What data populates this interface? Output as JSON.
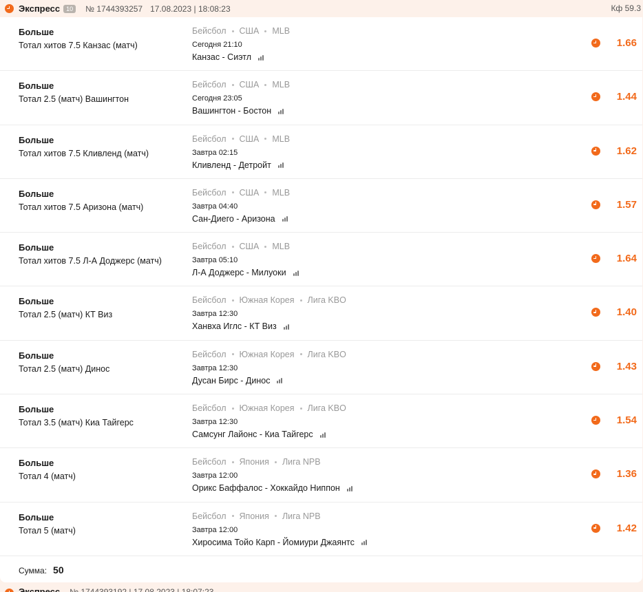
{
  "header": {
    "title": "Экспресс",
    "badge": "10",
    "number": "№ 1744393257",
    "date": "17.08.2023 | 18:08:23",
    "coef": "Кф 59.3"
  },
  "bets": [
    {
      "market": "Больше",
      "outcome": "Тотал хитов 7.5 Канзас (матч)",
      "sport": "Бейсбол",
      "country": "США",
      "league": "MLB",
      "time": "Сегодня 21:10",
      "match": "Канзас - Сиэтл",
      "odd": "1.66"
    },
    {
      "market": "Больше",
      "outcome": "Тотал 2.5 (матч) Вашингтон",
      "sport": "Бейсбол",
      "country": "США",
      "league": "MLB",
      "time": "Сегодня 23:05",
      "match": "Вашингтон - Бостон",
      "odd": "1.44"
    },
    {
      "market": "Больше",
      "outcome": "Тотал хитов 7.5 Кливленд (матч)",
      "sport": "Бейсбол",
      "country": "США",
      "league": "MLB",
      "time": "Завтра 02:15",
      "match": "Кливленд - Детройт",
      "odd": "1.62"
    },
    {
      "market": "Больше",
      "outcome": "Тотал хитов 7.5 Аризона (матч)",
      "sport": "Бейсбол",
      "country": "США",
      "league": "MLB",
      "time": "Завтра 04:40",
      "match": "Сан-Диего - Аризона",
      "odd": "1.57"
    },
    {
      "market": "Больше",
      "outcome": "Тотал хитов 7.5 Л-А Доджерс (матч)",
      "sport": "Бейсбол",
      "country": "США",
      "league": "MLB",
      "time": "Завтра 05:10",
      "match": "Л-А Доджерс - Милуоки",
      "odd": "1.64"
    },
    {
      "market": "Больше",
      "outcome": "Тотал 2.5 (матч) КТ Виз",
      "sport": "Бейсбол",
      "country": "Южная Корея",
      "league": "Лига KBO",
      "time": "Завтра 12:30",
      "match": "Ханвха Иглс - КТ Виз",
      "odd": "1.40"
    },
    {
      "market": "Больше",
      "outcome": "Тотал 2.5 (матч) Динос",
      "sport": "Бейсбол",
      "country": "Южная Корея",
      "league": "Лига KBO",
      "time": "Завтра 12:30",
      "match": "Дусан Бирс - Динос",
      "odd": "1.43"
    },
    {
      "market": "Больше",
      "outcome": "Тотал 3.5 (матч) Киа Тайгерс",
      "sport": "Бейсбол",
      "country": "Южная Корея",
      "league": "Лига KBO",
      "time": "Завтра 12:30",
      "match": "Самсунг Лайонс - Киа Тайгерс",
      "odd": "1.54"
    },
    {
      "market": "Больше",
      "outcome": "Тотал 4 (матч)",
      "sport": "Бейсбол",
      "country": "Япония",
      "league": "Лига NPB",
      "time": "Завтра 12:00",
      "match": "Орикс Баффалос - Хоккайдо Ниппон",
      "odd": "1.36"
    },
    {
      "market": "Больше",
      "outcome": "Тотал 5 (матч)",
      "sport": "Бейсбол",
      "country": "Япония",
      "league": "Лига NPB",
      "time": "Завтра 12:00",
      "match": "Хиросима Тойо Карп - Йомиури Джаянтс",
      "odd": "1.42"
    }
  ],
  "summary": {
    "label": "Сумма:",
    "value": "50"
  },
  "next_bet": {
    "title": "Экспресс",
    "number": "№ 1744393192 | 17.08.2023 | 18:07:23"
  },
  "colors": {
    "accent": "#f26a1b",
    "header_bg": "#fdf1ea",
    "muted": "#999999"
  },
  "icons": {
    "status": "clock-icon",
    "stats": "stats-icon"
  }
}
